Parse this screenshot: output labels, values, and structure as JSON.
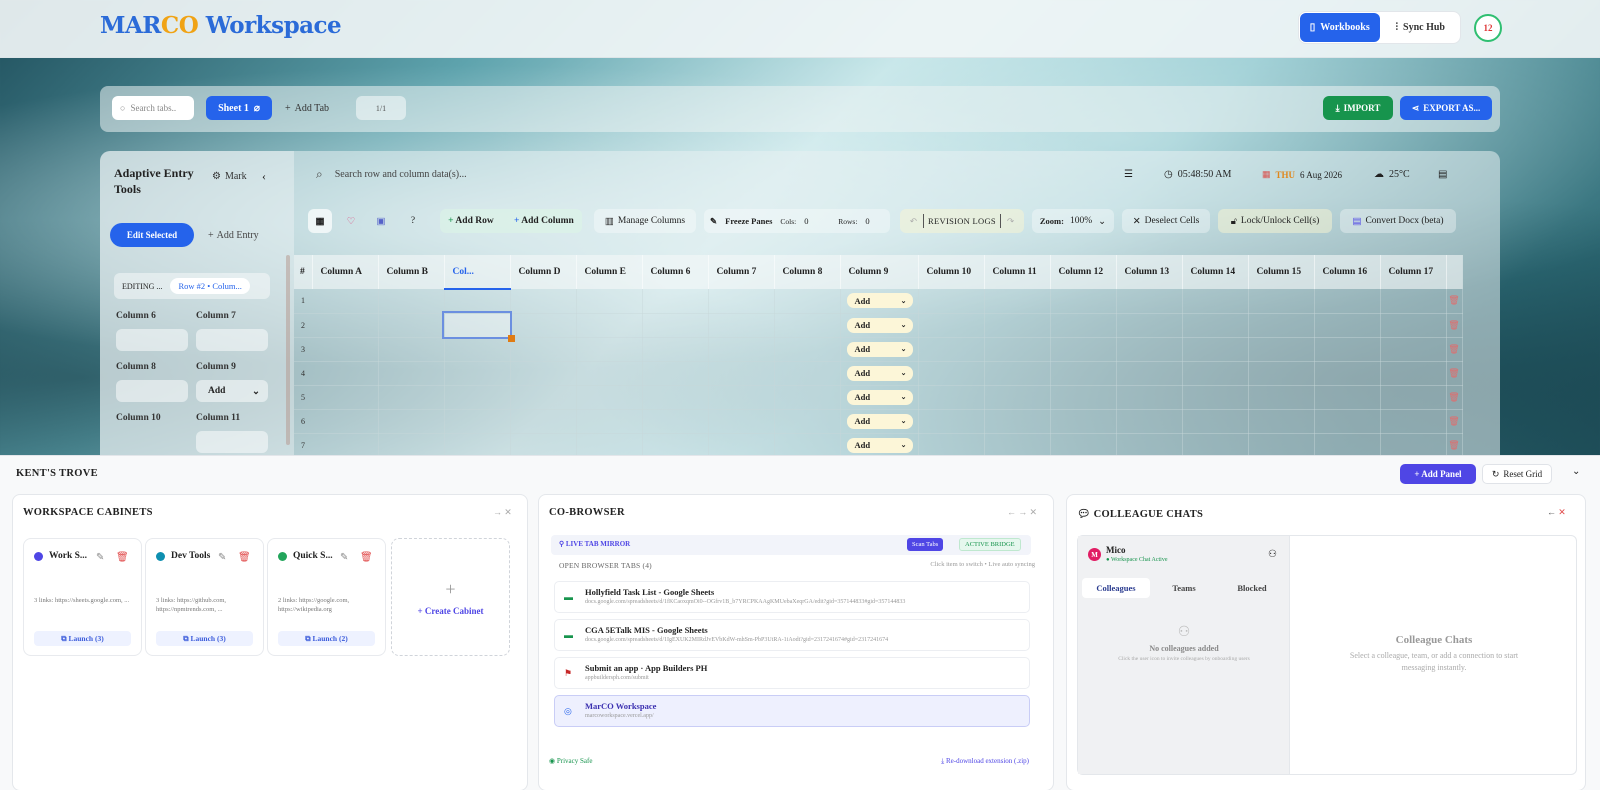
{
  "app": {
    "logo_a": "MAR",
    "logo_b": "CO",
    "logo_c": " Workspace"
  },
  "nav": {
    "workbooks": "Workbooks",
    "sync": "Sync Hub",
    "avatar": "12"
  },
  "tabs": {
    "search_placeholder": "Search tabs..",
    "sheet": "Sheet 1",
    "add": "Add Tab",
    "pager": "1/1",
    "import": "IMPORT",
    "export": "EXPORT AS..."
  },
  "left": {
    "title": "Adaptive Entry Tools",
    "mark": "Mark",
    "edit_selected": "Edit Selected",
    "add_entry": "Add Entry",
    "editing_label": "EDITING ...",
    "editing_chip": "Row #2 • Colum...",
    "fields": [
      "Column 6",
      "Column 7",
      "Column 8",
      "Column 9",
      "Column 10",
      "Column 11"
    ],
    "col9_value": "Add"
  },
  "toolbar": {
    "search_placeholder": "Search row and column data(s)...",
    "time": "05:48:50 AM",
    "day": "THU",
    "date": "6 Aug 2026",
    "temp": "25°C",
    "add_row": "Add Row",
    "add_column": "Add Column",
    "manage": "Manage Columns",
    "freeze": "Freeze Panes",
    "cols": "Cols:",
    "cols_v": "0",
    "rows": "Rows:",
    "rows_v": "0",
    "revision": "REVISION LOGS",
    "zoom": "Zoom:",
    "zoom_v": "100%",
    "deselect": "Deselect Cells",
    "lock": "Lock/Unlock Cell(s)",
    "convert": "Convert Docx (beta)"
  },
  "grid": {
    "headers": [
      "#",
      "Column A",
      "Column B",
      "Col...",
      "Column D",
      "Column E",
      "Column 6",
      "Column 7",
      "Column 8",
      "Column 9",
      "Column 10",
      "Column 11",
      "Column 12",
      "Column 13",
      "Column 14",
      "Column 15",
      "Column 16",
      "Column 17"
    ],
    "rows": [
      "1",
      "2",
      "3",
      "4",
      "5",
      "6",
      "7"
    ],
    "dropdown": "Add"
  },
  "trove": {
    "title": "KENT'S TROVE",
    "add_panel": "+ Add Panel",
    "reset": "Reset Grid"
  },
  "cabinets": {
    "title": "WORKSPACE CABINETS",
    "create": "+ Create Cabinet",
    "items": [
      {
        "name": "Work S...",
        "color": "#4f46e5",
        "links": "3 links: https://sheets.google.com, ...",
        "launch": "Launch (3)"
      },
      {
        "name": "Dev Tools",
        "color": "#0e8fb0",
        "links": "3 links: https://github.com, https://npmtrends.com, ...",
        "launch": "Launch (3)"
      },
      {
        "name": "Quick S...",
        "color": "#22a55b",
        "links": "2 links: https://google.com, https://wikipedia.org",
        "launch": "Launch (2)"
      }
    ]
  },
  "cobrowser": {
    "title": "CO-BROWSER",
    "mirror": "LIVE TAB MIRROR",
    "scan": "Scan Tabs",
    "bridge": "ACTIVE BRIDGE",
    "open_tabs": "OPEN BROWSER TABS (4)",
    "hint": "Click item to switch • Live auto syncing",
    "items": [
      {
        "title": "Hollyfield Task List - Google Sheets",
        "url": "docs.google.com/spreadsheets/d/1fKCaoxqmOi0--OGfrv1B_b7YRCPKAAgKMUebaXeqrGA/edit?gid=357144833#gid=357144833"
      },
      {
        "title": "CGA 5ETalk MIS - Google Sheets",
        "url": "docs.google.com/spreadsheets/d/1IgEXUK2MIRdJvEVbKdW-mhSm-PbP3UtRA-1iAodt?gid=2317241674#gid=2317241674"
      },
      {
        "title": "Submit an app · App Builders PH",
        "url": "appbuildersph.com/submit"
      },
      {
        "title": "MarCO Workspace",
        "url": "marcoworkspace.vercel.app/"
      }
    ],
    "privacy": "Privacy Safe",
    "redownload": "Re-download extension (.zip)"
  },
  "chats": {
    "title": "COLLEAGUE CHATS",
    "user": "Mico",
    "status": "Workspace Chat Active",
    "tabs": [
      "Colleagues",
      "Teams",
      "Blocked"
    ],
    "empty": "No colleagues added",
    "empty_hint": "Click the user icon to invite colleagues by onboarding users",
    "right_title": "Colleague Chats",
    "right_body": "Select a colleague, team, or add a connection to start messaging instantly."
  }
}
